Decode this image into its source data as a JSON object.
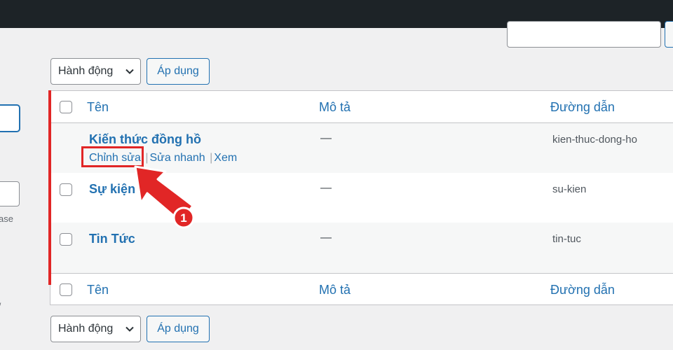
{
  "bulk_actions": {
    "select_label": "Hành động",
    "apply_label": "Áp dụng"
  },
  "sidebar": {
    "partial_text": "ase",
    "partial_mark": "/"
  },
  "table": {
    "columns": [
      "Tên",
      "Mô tả",
      "Đường dẫn"
    ],
    "rows": [
      {
        "name": "Kiến thức đồng hồ",
        "description": "—",
        "slug": "kien-thuc-dong-ho"
      },
      {
        "name": "Sự kiện",
        "description": "—",
        "slug": "su-kien"
      },
      {
        "name": "Tin Tức",
        "description": "—",
        "slug": "tin-tuc"
      }
    ],
    "row_actions": {
      "edit": "Chỉnh sửa",
      "quick_edit": "Sửa nhanh",
      "view": "Xem",
      "separator": "|"
    }
  },
  "annotation": {
    "step_number": "1",
    "color": "#e12626"
  },
  "colors": {
    "admin_bar": "#1d2327",
    "link": "#2271b1",
    "background": "#f0f0f1"
  }
}
